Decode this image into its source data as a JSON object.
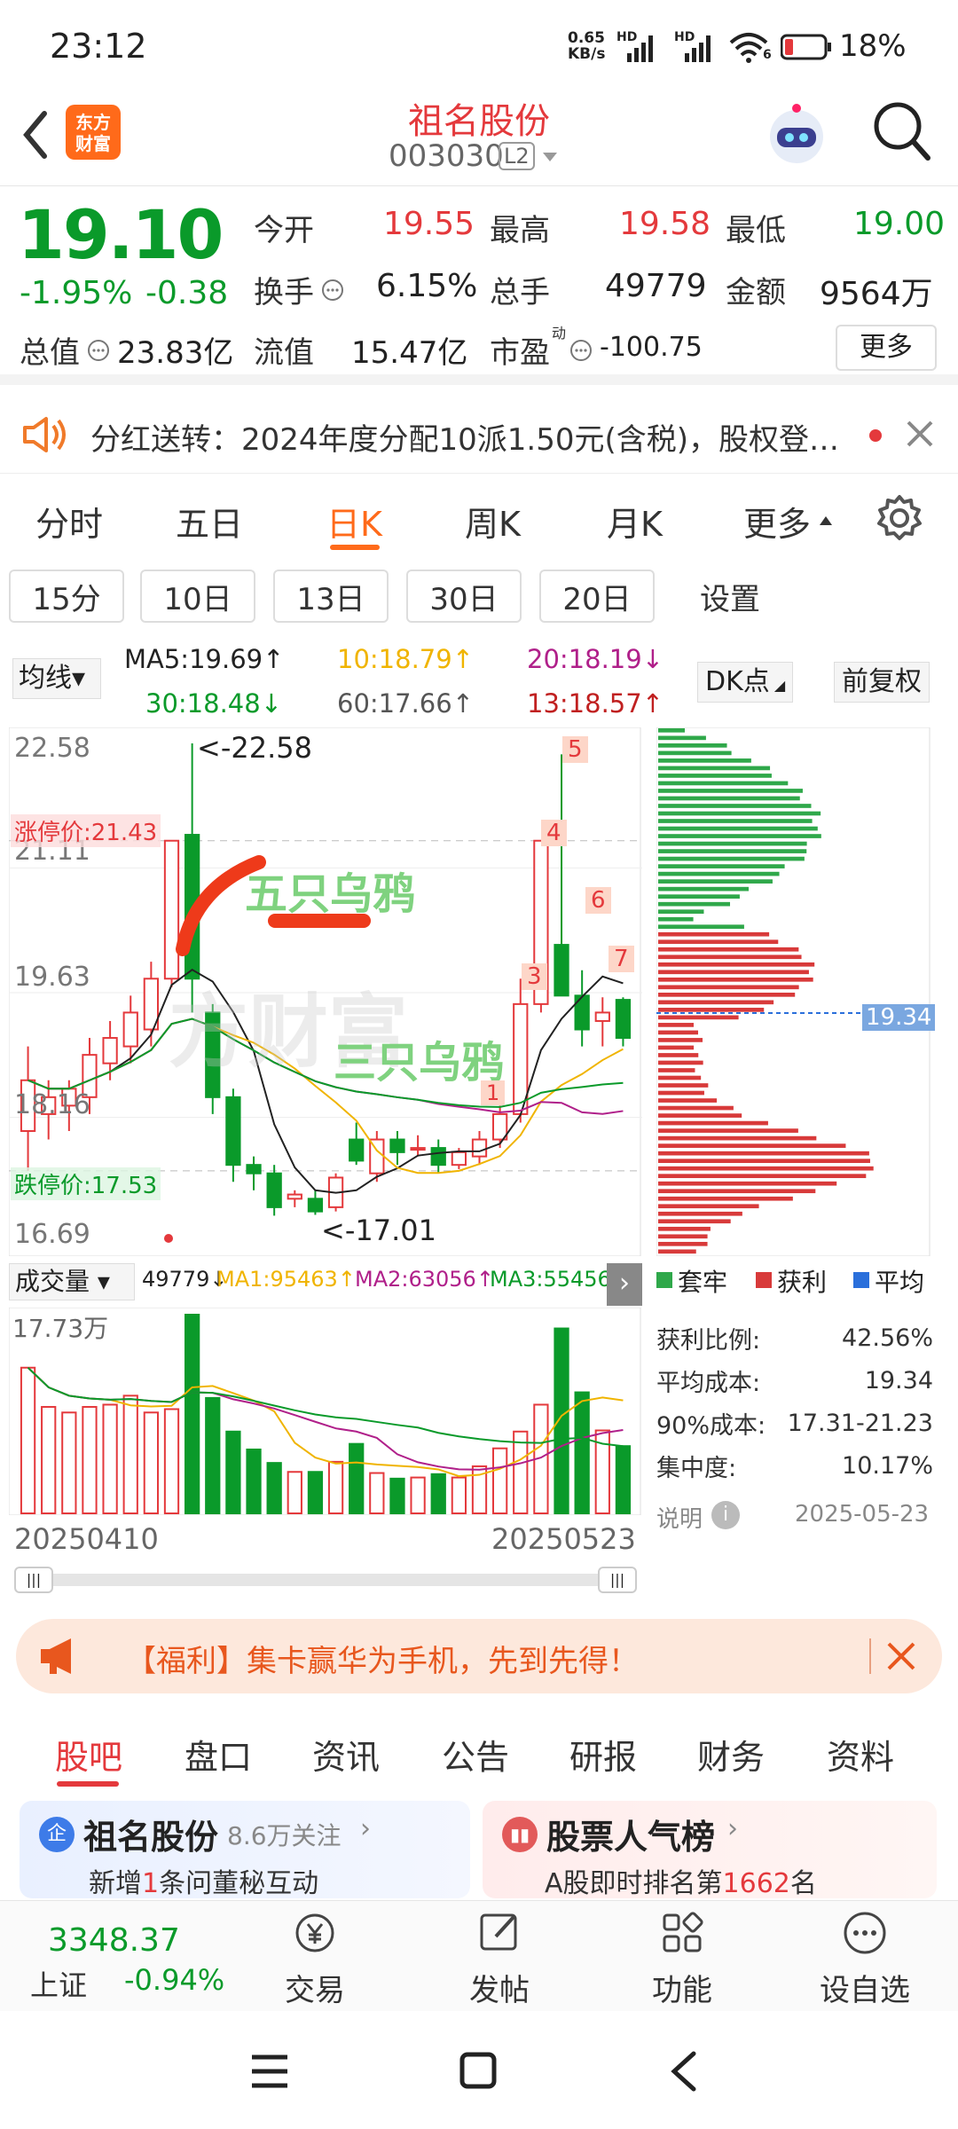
{
  "status": {
    "time": "23:12",
    "net_speed_top": "0.65",
    "net_speed_bottom": "KB/s",
    "hd1": "HD",
    "hd2": "HD",
    "wifi_num": "6",
    "battery": "18%"
  },
  "header": {
    "title": "祖名股份",
    "code": "003030",
    "level": "L2",
    "logo_line1": "东方",
    "logo_line2": "财富"
  },
  "quote": {
    "price": "19.10",
    "change_pct": "-1.95%",
    "change": "-0.38",
    "open_label": "今开",
    "open": "19.55",
    "high_label": "最高",
    "high": "19.58",
    "low_label": "最低",
    "low": "19.00",
    "turnover_label": "换手",
    "turnover": "6.15%",
    "volume_label": "总手",
    "volume": "49779",
    "amount_label": "金额",
    "amount": "9564万",
    "mcap_label": "总值",
    "mcap": "23.83亿",
    "float_label": "流值",
    "float": "15.47亿",
    "pe_label": "市盈",
    "pe_sup": "动",
    "pe": "-100.75",
    "more": "更多"
  },
  "notice": {
    "text": "分红送转：2024年度分配10派1.50元(含税)，股权登…"
  },
  "ktabs": [
    "分时",
    "五日",
    "日K",
    "周K",
    "月K",
    "更多"
  ],
  "periods": [
    "15分",
    "10日",
    "13日",
    "30日",
    "20日",
    "设置"
  ],
  "ma": {
    "select": "均线",
    "ma5": "MA5:19.69↑",
    "ma10": "10:18.79↑",
    "ma20": "20:18.19↓",
    "ma30": "30:18.48↓",
    "ma60": "60:17.66↑",
    "ma13": "13:18.57↑",
    "dk": "DK点",
    "fq": "前复权"
  },
  "kchart": {
    "y_labels": [
      "22.58",
      "21.11",
      "19.63",
      "18.16",
      "16.69"
    ],
    "high_mark": "<-22.58",
    "low_mark": "<-17.01",
    "limit_up": "涨停价:21.43",
    "limit_down": "跌停价:17.53",
    "annot1": "五只乌鸦",
    "annot2": "三只乌鸦",
    "watermark": "方财富",
    "nums": [
      "1",
      "3",
      "4",
      "5",
      "6",
      "7"
    ]
  },
  "vol": {
    "select": "成交量",
    "v": "49779↓",
    "ma1": "MA1:95463↑",
    "ma2": "MA2:63056↑",
    "ma3": "MA3:55456↓",
    "max": "17.73万",
    "date_start": "20250410",
    "date_end": "20250523"
  },
  "dist": {
    "avg_tag": "19.34",
    "legend": [
      "套牢",
      "获利",
      "平均"
    ],
    "stats": [
      {
        "label": "获利比例:",
        "value": "42.56%"
      },
      {
        "label": "平均成本:",
        "value": "19.34"
      },
      {
        "label": "90%成本:",
        "value": "17.31-21.23"
      },
      {
        "label": "集中度:",
        "value": "10.17%"
      }
    ],
    "note": "说明",
    "date": "2025-05-23"
  },
  "banner": {
    "text": "【福利】集卡赢华为手机，先到先得！"
  },
  "tabs2": [
    "股吧",
    "盘口",
    "资讯",
    "公告",
    "研报",
    "财务",
    "资料"
  ],
  "cards": {
    "c1_badge": "企",
    "c1_title": "祖名股份",
    "c1_follow": "8.6万关注",
    "c1_sub_pre": "新增",
    "c1_sub_num": "1",
    "c1_sub_post": "条问董秘互动",
    "c2_title": "股票人气榜",
    "c2_sub_pre": "A股即时排名第",
    "c2_sub_num": "1662",
    "c2_sub_post": "名"
  },
  "bottom": {
    "index_value": "3348.37",
    "index_name": "上证",
    "index_change": "-0.94%",
    "items": [
      "交易",
      "发帖",
      "功能",
      "设自选"
    ]
  },
  "colors": {
    "up": "#e4393c",
    "down": "#0a9a2a",
    "accent": "#ff6a1a"
  },
  "chart_data": {
    "type": "candlestick",
    "ylim": [
      16.69,
      22.58
    ],
    "candles": [
      {
        "o": 18.0,
        "h": 19.0,
        "l": 17.53,
        "c": 18.6
      },
      {
        "o": 18.2,
        "h": 18.6,
        "l": 17.9,
        "c": 18.4
      },
      {
        "o": 18.3,
        "h": 18.6,
        "l": 18.0,
        "c": 18.5
      },
      {
        "o": 18.4,
        "h": 19.1,
        "l": 18.2,
        "c": 18.9
      },
      {
        "o": 18.8,
        "h": 19.3,
        "l": 18.6,
        "c": 19.1
      },
      {
        "o": 19.0,
        "h": 19.6,
        "l": 18.8,
        "c": 19.4
      },
      {
        "o": 19.2,
        "h": 20.0,
        "l": 19.0,
        "c": 19.8
      },
      {
        "o": 19.8,
        "h": 21.43,
        "l": 19.7,
        "c": 21.43
      },
      {
        "o": 21.5,
        "h": 22.58,
        "l": 19.4,
        "c": 19.8
      },
      {
        "o": 19.4,
        "h": 19.5,
        "l": 18.2,
        "c": 18.4
      },
      {
        "o": 18.4,
        "h": 18.5,
        "l": 17.4,
        "c": 17.6
      },
      {
        "o": 17.6,
        "h": 17.7,
        "l": 17.3,
        "c": 17.5
      },
      {
        "o": 17.5,
        "h": 17.6,
        "l": 17.0,
        "c": 17.1
      },
      {
        "o": 17.2,
        "h": 17.3,
        "l": 17.1,
        "c": 17.25
      },
      {
        "o": 17.2,
        "h": 17.3,
        "l": 17.01,
        "c": 17.05
      },
      {
        "o": 17.1,
        "h": 17.5,
        "l": 17.05,
        "c": 17.45
      },
      {
        "o": 17.9,
        "h": 18.1,
        "l": 17.6,
        "c": 17.65
      },
      {
        "o": 17.5,
        "h": 18.0,
        "l": 17.4,
        "c": 17.9
      },
      {
        "o": 17.9,
        "h": 18.0,
        "l": 17.6,
        "c": 17.75
      },
      {
        "o": 17.8,
        "h": 17.95,
        "l": 17.7,
        "c": 17.8
      },
      {
        "o": 17.8,
        "h": 17.9,
        "l": 17.5,
        "c": 17.6
      },
      {
        "o": 17.6,
        "h": 17.8,
        "l": 17.55,
        "c": 17.75
      },
      {
        "o": 17.7,
        "h": 18.0,
        "l": 17.6,
        "c": 17.9
      },
      {
        "o": 17.9,
        "h": 18.3,
        "l": 17.8,
        "c": 18.2
      },
      {
        "o": 18.2,
        "h": 19.8,
        "l": 18.1,
        "c": 19.5
      },
      {
        "o": 19.5,
        "h": 21.43,
        "l": 19.4,
        "c": 21.43
      },
      {
        "o": 20.2,
        "h": 22.45,
        "l": 19.8,
        "c": 19.6
      },
      {
        "o": 19.6,
        "h": 19.9,
        "l": 19.0,
        "c": 19.2
      },
      {
        "o": 19.3,
        "h": 19.58,
        "l": 19.0,
        "c": 19.4
      },
      {
        "o": 19.55,
        "h": 19.58,
        "l": 19.0,
        "c": 19.1
      }
    ],
    "volume": [
      13,
      9.5,
      9,
      9.5,
      9.7,
      10.5,
      9,
      9.3,
      17.73,
      10.3,
      7.3,
      5.7,
      4.5,
      3.7,
      3.7,
      4.6,
      6.2,
      3.6,
      3.1,
      3.2,
      3.5,
      3.2,
      4.2,
      5.8,
      7.3,
      9.7,
      16.5,
      10.8,
      7.4,
      6
    ]
  }
}
